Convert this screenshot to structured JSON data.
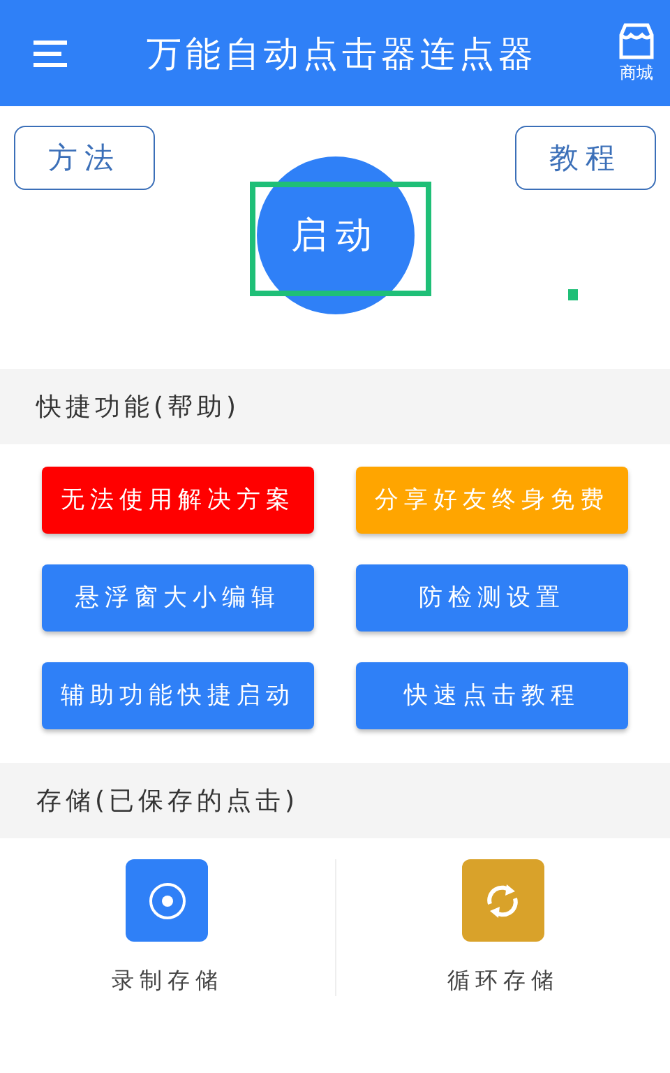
{
  "header": {
    "title": "万能自动点击器连点器",
    "store_label": "商城"
  },
  "top_buttons": [
    "方法",
    "教程"
  ],
  "start_button": {
    "label": "启动",
    "highlighted": true
  },
  "quick_section": {
    "title": "快捷功能(帮助)",
    "buttons": [
      {
        "label": "无法使用解决方案",
        "color": "#ff0000"
      },
      {
        "label": "分享好友终身免费",
        "color": "#ffa500"
      },
      {
        "label": "悬浮窗大小编辑",
        "color": "#2f80f7"
      },
      {
        "label": "防检测设置",
        "color": "#2f80f7"
      },
      {
        "label": "辅助功能快捷启动",
        "color": "#2f80f7"
      },
      {
        "label": "快速点击教程",
        "color": "#2f80f7"
      }
    ]
  },
  "storage_section": {
    "title": "存储(已保存的点击)",
    "items": [
      {
        "label": "录制存储",
        "kind": "record",
        "color": "#2f80f7"
      },
      {
        "label": "循环存储",
        "kind": "loop",
        "color": "#d9a22a"
      }
    ]
  }
}
